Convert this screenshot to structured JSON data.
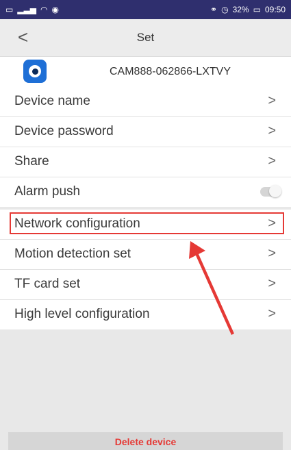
{
  "status_bar": {
    "left_icons": [
      "sim-icon",
      "signal-icon",
      "wifi-icon",
      "app-notification-icon"
    ],
    "battery_percent": "32%",
    "time": "09:50"
  },
  "nav": {
    "back_label": "<",
    "title": "Set"
  },
  "device": {
    "id": "CAM888-062866-LXTVY"
  },
  "section1": {
    "items": [
      {
        "label": "Device name",
        "chevron": ">"
      },
      {
        "label": "Device password",
        "chevron": ">"
      },
      {
        "label": "Share",
        "chevron": ">"
      },
      {
        "label": "Alarm push",
        "toggle": "off"
      }
    ]
  },
  "section2": {
    "items": [
      {
        "label": "Network configuration",
        "chevron": ">"
      },
      {
        "label": "Motion detection set",
        "chevron": ">"
      },
      {
        "label": "TF card set",
        "chevron": ">"
      },
      {
        "label": "High level configuration",
        "chevron": ">"
      }
    ]
  },
  "bottom": {
    "delete_label": "Delete device"
  },
  "colors": {
    "status_bar": "#2f2f6e",
    "accent_red": "#e53935",
    "logo_blue": "#1e6fd6"
  }
}
